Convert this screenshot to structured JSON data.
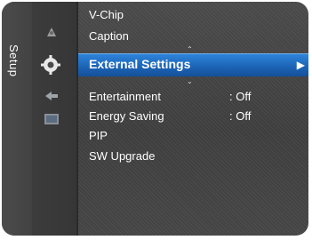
{
  "side_tab": {
    "label": "Setup"
  },
  "icons": [
    "picture-icon",
    "setup-gear-icon",
    "input-icon",
    "application-icon"
  ],
  "menu": {
    "items_above": [
      {
        "label": "V-Chip"
      },
      {
        "label": "Caption"
      }
    ],
    "selected": {
      "label": "External Settings",
      "arrow": "▶"
    },
    "items_below": [
      {
        "label": "Entertainment",
        "value": ": Off"
      },
      {
        "label": "Energy Saving",
        "value": ": Off"
      },
      {
        "label": "PIP",
        "value": ""
      },
      {
        "label": "SW Upgrade",
        "value": ""
      }
    ],
    "scroll_up": "⌃",
    "scroll_down": "⌄"
  },
  "colors": {
    "highlight": "#1c63b4",
    "background": "#424242",
    "text": "#ffffff"
  }
}
